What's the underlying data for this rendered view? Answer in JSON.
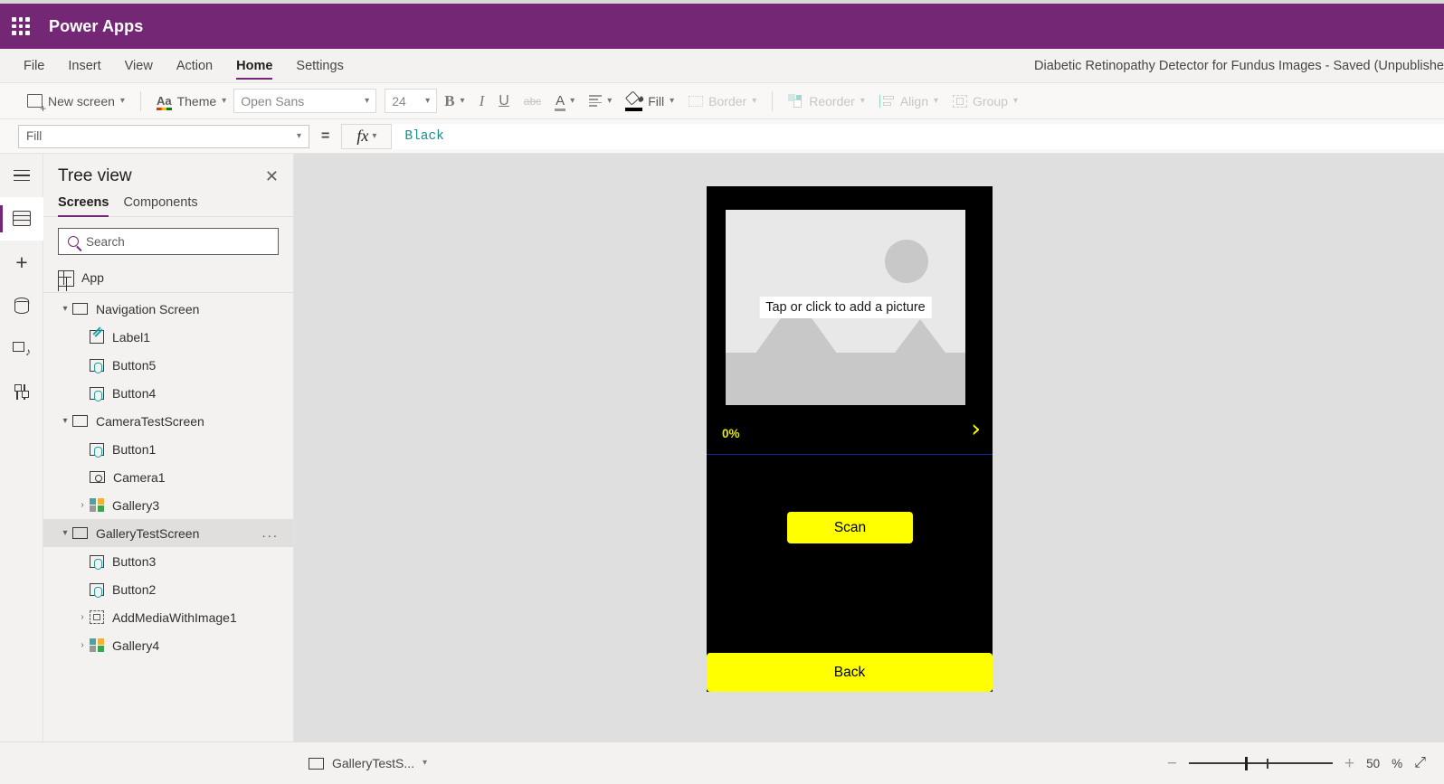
{
  "brand": {
    "title": "Power Apps",
    "waffle_icon": "waffle-grid-icon",
    "bar_color": "#742774"
  },
  "menubar": {
    "items": [
      {
        "label": "File",
        "active": false
      },
      {
        "label": "Insert",
        "active": false
      },
      {
        "label": "View",
        "active": false
      },
      {
        "label": "Action",
        "active": false
      },
      {
        "label": "Home",
        "active": true
      },
      {
        "label": "Settings",
        "active": false
      }
    ],
    "document_title": "Diabetic Retinopathy Detector for Fundus Images - Saved (Unpublishe"
  },
  "ribbon": {
    "new_screen": "New screen",
    "theme": "Theme",
    "font_family": "Open Sans",
    "font_size": "24",
    "bold": "B",
    "italic": "I",
    "underline": "U",
    "strikethrough": "abc",
    "font_color": "A",
    "align": "align-text-icon",
    "fill": "Fill",
    "border": "Border",
    "reorder": "Reorder",
    "align_label": "Align",
    "group": "Group"
  },
  "formula_bar": {
    "property": "Fill",
    "equals": "=",
    "fx": "fx",
    "value": "Black",
    "value_color": "#1a8c8c"
  },
  "rail": {
    "items": [
      {
        "name": "hamburger-menu",
        "active": false
      },
      {
        "name": "tree-view-layers",
        "active": true
      },
      {
        "name": "insert-plus",
        "active": false
      },
      {
        "name": "data-sources",
        "active": false
      },
      {
        "name": "media",
        "active": false
      },
      {
        "name": "advanced-tools",
        "active": false
      }
    ]
  },
  "tree_panel": {
    "title": "Tree view",
    "close": "✕",
    "tabs": [
      {
        "label": "Screens",
        "active": true
      },
      {
        "label": "Components",
        "active": false
      }
    ],
    "search_placeholder": "Search",
    "app_item": "App",
    "items": [
      {
        "label": "Navigation Screen",
        "icon": "screen-icon",
        "indent": 0,
        "expander": "▾",
        "selected": false
      },
      {
        "label": "Label1",
        "icon": "label-icon",
        "indent": 1,
        "expander": "",
        "selected": false
      },
      {
        "label": "Button5",
        "icon": "button-icon",
        "indent": 1,
        "expander": "",
        "selected": false
      },
      {
        "label": "Button4",
        "icon": "button-icon",
        "indent": 1,
        "expander": "",
        "selected": false
      },
      {
        "label": "CameraTestScreen",
        "icon": "screen-icon",
        "indent": 0,
        "expander": "▾",
        "selected": false
      },
      {
        "label": "Button1",
        "icon": "button-icon",
        "indent": 1,
        "expander": "",
        "selected": false
      },
      {
        "label": "Camera1",
        "icon": "camera-icon",
        "indent": 1,
        "expander": "",
        "selected": false
      },
      {
        "label": "Gallery3",
        "icon": "gallery-icon",
        "indent": 1,
        "expander": "›",
        "selected": false
      },
      {
        "label": "GalleryTestScreen",
        "icon": "screen-icon",
        "indent": 0,
        "expander": "▾",
        "selected": true,
        "overflow": "..."
      },
      {
        "label": "Button3",
        "icon": "button-icon",
        "indent": 1,
        "expander": "",
        "selected": false
      },
      {
        "label": "Button2",
        "icon": "button-icon",
        "indent": 1,
        "expander": "",
        "selected": false
      },
      {
        "label": "AddMediaWithImage1",
        "icon": "media-control-icon",
        "indent": 1,
        "expander": "›",
        "selected": false
      },
      {
        "label": "Gallery4",
        "icon": "gallery-icon",
        "indent": 1,
        "expander": "›",
        "selected": false
      }
    ]
  },
  "canvas": {
    "background_color": "#dfdfdf",
    "phone": {
      "screen_fill": "#000000",
      "image_placeholder_text": "Tap or click to add a picture",
      "progress_text": "0%",
      "progress_color": "#e8e800",
      "next_chevron": "›",
      "next_chevron_color": "#ffff00",
      "scan_button": "Scan",
      "back_button": "Back",
      "accent_color": "#ffff00"
    }
  },
  "statusbar": {
    "screen_name": "GalleryTestS...",
    "zoom_minus": "−",
    "zoom_plus": "+",
    "zoom_value": "50",
    "zoom_unit": "%",
    "fit_icon": "expand-diagonal-icon"
  }
}
